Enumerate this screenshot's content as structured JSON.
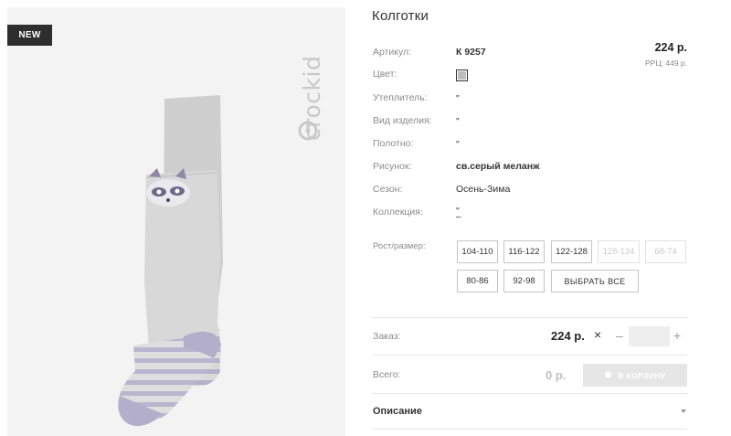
{
  "badge": "NEW",
  "brand": "crockid",
  "product": {
    "title": "Колготки",
    "price": "224 р.",
    "rrp": "РРЦ: 449 р."
  },
  "attributes": {
    "article": {
      "label": "Артикул:",
      "value": "К 9257"
    },
    "color": {
      "label": "Цвет:",
      "swatch": "#bdbdbd"
    },
    "insulation": {
      "label": "Утеплитель:",
      "value": "\""
    },
    "item_type": {
      "label": "Вид изделия:",
      "value": "\""
    },
    "fabric": {
      "label": "Полотно:",
      "value": "\""
    },
    "pattern": {
      "label": "Рисунок:",
      "value": "св.серый меланж"
    },
    "season": {
      "label": "Сезон:",
      "value": "Осень-Зима"
    },
    "collection": {
      "label": "Коллекция:",
      "value": "\"",
      "extra": "–"
    }
  },
  "sizes": {
    "label": "Рост/размер:",
    "options": [
      {
        "label": "104-110",
        "available": true
      },
      {
        "label": "116-122",
        "available": true
      },
      {
        "label": "122-128",
        "available": true
      },
      {
        "label": "128-134",
        "available": false
      },
      {
        "label": "68-74",
        "available": false
      },
      {
        "label": "80-86",
        "available": true
      },
      {
        "label": "92-98",
        "available": true
      }
    ],
    "select_all": "ВЫБРАТЬ ВСЕ"
  },
  "order": {
    "label": "Заказ:",
    "price": "224 р.",
    "times": "×",
    "minus": "–",
    "plus": "+",
    "quantity": ""
  },
  "total": {
    "label": "Всего:",
    "value": "0 р.",
    "cart_button": "В КОРЗИНУ"
  },
  "description": {
    "label": "Описание"
  },
  "colors": {
    "accent_dark": "#2e2e2e",
    "tights_gray": "#d7d7d7",
    "lavender": "#b3aec9"
  }
}
